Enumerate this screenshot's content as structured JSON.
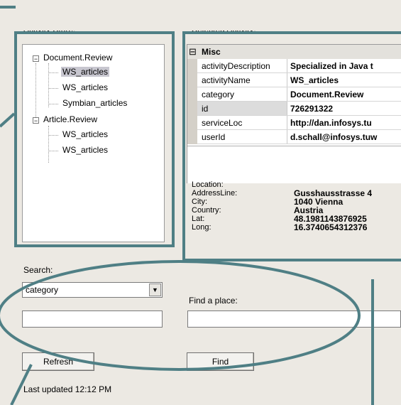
{
  "labels": {
    "activity_store": "Activity Store:",
    "selected_activity": "Selected Activity:",
    "search": "Search:",
    "find_a_place": "Find a place:"
  },
  "tree": [
    {
      "label": "Document.Review",
      "expander": "−"
    },
    {
      "label": "WS_articles",
      "selected": true
    },
    {
      "label": "WS_articles"
    },
    {
      "label": "Symbian_articles"
    },
    {
      "label": "Article.Review",
      "expander": "−"
    },
    {
      "label": "WS_articles"
    },
    {
      "label": "WS_articles"
    }
  ],
  "properties": {
    "category": "Misc",
    "category_expander": "⊟",
    "rows": [
      {
        "name": "activityDescription",
        "value": "Specialized in Java t"
      },
      {
        "name": "activityName",
        "value": "WS_articles"
      },
      {
        "name": "category",
        "value": "Document.Review"
      },
      {
        "name": "id",
        "value": "726291322"
      },
      {
        "name": "serviceLoc",
        "value": "http://dan.infosys.tu"
      },
      {
        "name": "userId",
        "value": "d.schall@infosys.tuw"
      }
    ]
  },
  "location": {
    "header": "Location:",
    "rows": [
      {
        "key": "AddressLine:",
        "value": "Gusshausstrasse 4"
      },
      {
        "key": "City:",
        "value": "1040 Vienna"
      },
      {
        "key": "Country:",
        "value": "Austria"
      },
      {
        "key": "Lat:",
        "value": "48.1981143876925"
      },
      {
        "key": "Long:",
        "value": "16.3740654312376"
      }
    ]
  },
  "search": {
    "field_selected": "category",
    "query_value": "",
    "place_value": ""
  },
  "buttons": {
    "refresh": "Refresh",
    "find": "Find"
  },
  "status": {
    "last_updated": "Last updated 12:12 PM"
  },
  "colors": {
    "annotation": "#4f7f85",
    "background": "#ece9e3",
    "selection": "#c7c6cf"
  }
}
